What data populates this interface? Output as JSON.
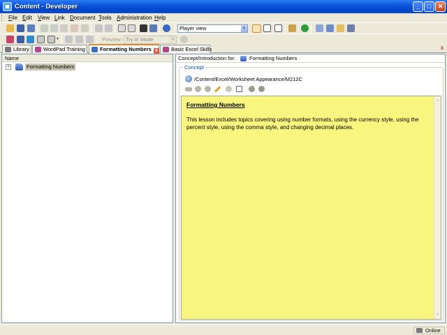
{
  "window": {
    "title": "Content - Developer",
    "minimize": "_",
    "maximize": "□",
    "close": "✕"
  },
  "menu": [
    {
      "ul": "F",
      "rest": "ile"
    },
    {
      "ul": "E",
      "rest": "dit"
    },
    {
      "ul": "V",
      "rest": "iew"
    },
    {
      "ul": "L",
      "rest": "ink"
    },
    {
      "ul": "D",
      "rest": "ocument"
    },
    {
      "ul": "T",
      "rest": "ools"
    },
    {
      "ul": "A",
      "rest": "dministration"
    },
    {
      "ul": "H",
      "rest": "elp"
    }
  ],
  "toolbar": {
    "view_select": "Player view",
    "preview_label": "Preview:",
    "mode_select": "Try It! Mode"
  },
  "tabs": [
    {
      "label": "Library",
      "icon": "library-icon"
    },
    {
      "label": "WordPad Training",
      "icon": "book-icon"
    },
    {
      "label": "Formatting Numbers",
      "icon": "concept-icon",
      "active": true,
      "close": "x"
    },
    {
      "label": "Basic Excel Skills",
      "icon": "book-icon"
    }
  ],
  "panel_close": "x",
  "outline": {
    "column_header": "Name",
    "expander": "+",
    "root": "Formatting Numbers"
  },
  "concept": {
    "intro_label": "Concept/Introduction for:",
    "intro_value": "Formatting Numbers",
    "group_legend": "Concept",
    "path": "/Content/Excel/Worksheet Appearance/M212C",
    "heading": "Formatting Numbers",
    "body": "This lesson includes topics covering using number formats, using the currency style, using the percent style, using the comma style, and changing decimal places."
  },
  "status": {
    "connection": "Online"
  },
  "colors": {
    "title_bar": "#0a53d8",
    "editor_bg": "#f8f67e",
    "active_tab_accent": "#e68b2c",
    "group_legend": "#0046d5"
  }
}
